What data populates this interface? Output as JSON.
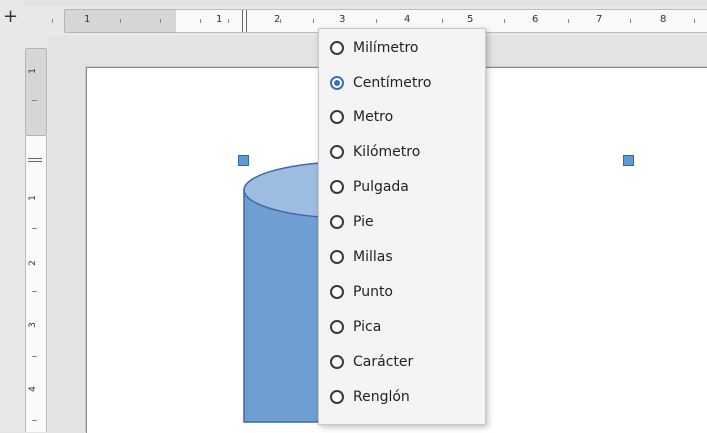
{
  "ruler": {
    "corner_symbol": "+",
    "h_labels": [
      "1",
      "1",
      "2",
      "3",
      "4",
      "5",
      "6",
      "7",
      "8"
    ],
    "v_labels": [
      "1",
      "1",
      "2",
      "3",
      "4"
    ]
  },
  "menu": {
    "items": [
      {
        "label": "Milímetro",
        "checked": false
      },
      {
        "label": "Centímetro",
        "checked": true
      },
      {
        "label": "Metro",
        "checked": false
      },
      {
        "label": "Kilómetro",
        "checked": false
      },
      {
        "label": "Pulgada",
        "checked": false
      },
      {
        "label": "Pie",
        "checked": false
      },
      {
        "label": "Millas",
        "checked": false
      },
      {
        "label": "Punto",
        "checked": false
      },
      {
        "label": "Pica",
        "checked": false
      },
      {
        "label": "Carácter",
        "checked": false
      },
      {
        "label": "Renglón",
        "checked": false
      }
    ]
  },
  "colors": {
    "cylinder_fill": "#6f9fd2",
    "cylinder_top": "#9dbde0",
    "cylinder_stroke": "#3c6aa5",
    "handle": "#5b9bd5",
    "radio_selected": "#3b6fb6"
  }
}
